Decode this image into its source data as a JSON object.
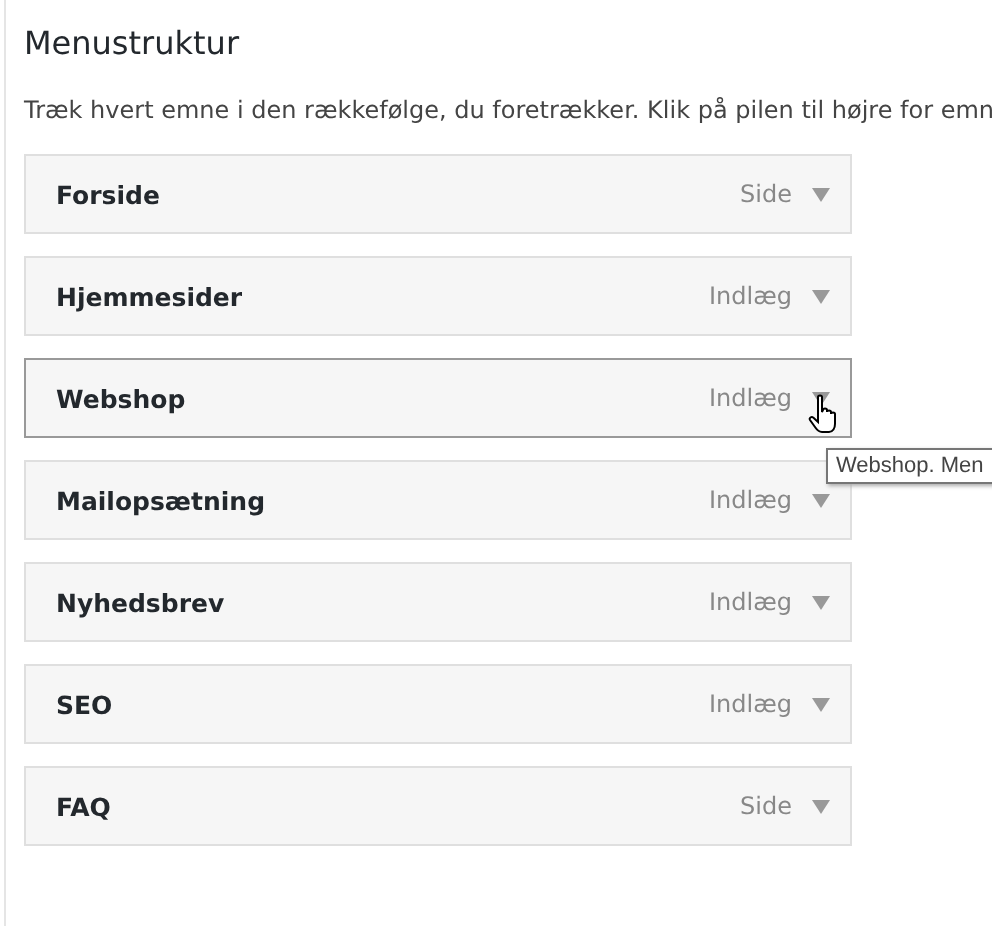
{
  "title": "Menustruktur",
  "description": "Træk hvert emne i den rækkefølge, du foretrækker. Klik på pilen til højre for emn",
  "items": [
    {
      "label": "Forside",
      "type": "Side",
      "hovered": false
    },
    {
      "label": "Hjemmesider",
      "type": "Indlæg",
      "hovered": false
    },
    {
      "label": "Webshop",
      "type": "Indlæg",
      "hovered": true,
      "tooltip": "Webshop. Men"
    },
    {
      "label": "Mailopsætning",
      "type": "Indlæg",
      "hovered": false
    },
    {
      "label": "Nyhedsbrev",
      "type": "Indlæg",
      "hovered": false
    },
    {
      "label": "SEO",
      "type": "Indlæg",
      "hovered": false
    },
    {
      "label": "FAQ",
      "type": "Side",
      "hovered": false
    }
  ]
}
